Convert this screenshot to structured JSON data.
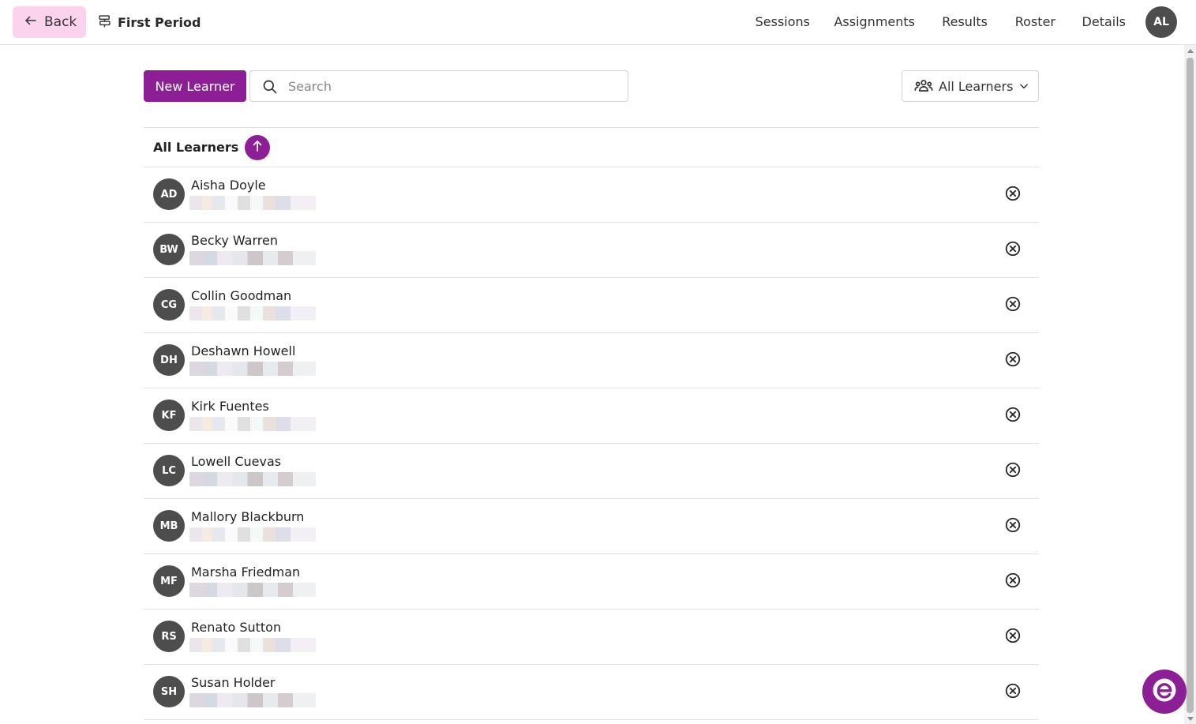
{
  "header": {
    "back_label": "Back",
    "period_title": "First Period",
    "nav": [
      {
        "label": "Sessions",
        "active": false
      },
      {
        "label": "Assignments",
        "active": false
      },
      {
        "label": "Results",
        "active": false
      },
      {
        "label": "Roster",
        "active": true
      },
      {
        "label": "Details",
        "active": false
      }
    ],
    "user_initials": "AL"
  },
  "toolbar": {
    "new_learner_label": "New Learner",
    "search_placeholder": "Search",
    "search_value": "",
    "filter_label": "All Learners"
  },
  "list": {
    "header_label": "All Learners",
    "sort_direction": "ascending",
    "learners": [
      {
        "initials": "AD",
        "name": "Aisha Doyle"
      },
      {
        "initials": "BW",
        "name": "Becky Warren"
      },
      {
        "initials": "CG",
        "name": "Collin Goodman"
      },
      {
        "initials": "DH",
        "name": "Deshawn Howell"
      },
      {
        "initials": "KF",
        "name": "Kirk Fuentes"
      },
      {
        "initials": "LC",
        "name": "Lowell Cuevas"
      },
      {
        "initials": "MB",
        "name": "Mallory Blackburn"
      },
      {
        "initials": "MF",
        "name": "Marsha Friedman"
      },
      {
        "initials": "RS",
        "name": "Renato Sutton"
      },
      {
        "initials": "SH",
        "name": "Susan Holder"
      }
    ]
  },
  "icons": {
    "back": "arrow-left-icon",
    "period": "signpost-icon",
    "search": "search-icon",
    "filter": "users-group-icon",
    "dropdown": "chevron-down-icon",
    "sort": "arrow-up-icon",
    "remove": "circle-x-icon",
    "help": "help-chat-icon"
  },
  "colors": {
    "brand": "#8d1f96",
    "back_button": "#fbd3ec",
    "avatar": "#4d4d4d",
    "active_nav_outline": "#e03c3c"
  }
}
